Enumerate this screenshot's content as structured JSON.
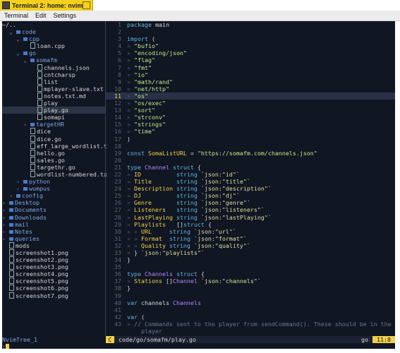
{
  "window": {
    "title": "Terminal 2: home: nvim"
  },
  "menu": [
    "Terminal",
    "Edit",
    "Settings"
  ],
  "tree": {
    "root": "~/..",
    "items": [
      {
        "indent": 1,
        "kind": "dir",
        "open": true,
        "name": "code"
      },
      {
        "indent": 2,
        "kind": "dir",
        "open": true,
        "name": "cpp"
      },
      {
        "indent": 3,
        "kind": "file",
        "name": "loan.cpp"
      },
      {
        "indent": 2,
        "kind": "dir",
        "open": true,
        "name": "go"
      },
      {
        "indent": 3,
        "kind": "dir",
        "open": true,
        "name": "somafm"
      },
      {
        "indent": 4,
        "kind": "file",
        "name": "channels.json"
      },
      {
        "indent": 4,
        "kind": "file",
        "name": "cntcharsp"
      },
      {
        "indent": 4,
        "kind": "file",
        "name": "list"
      },
      {
        "indent": 4,
        "kind": "file",
        "name": "mplayer-slave.txt"
      },
      {
        "indent": 4,
        "kind": "file",
        "name": "notes.txt.md"
      },
      {
        "indent": 4,
        "kind": "file",
        "name": "play"
      },
      {
        "indent": 4,
        "kind": "file",
        "name": "play.go",
        "selected": true
      },
      {
        "indent": 4,
        "kind": "file",
        "name": "somapi"
      },
      {
        "indent": 3,
        "kind": "dir",
        "open": false,
        "name": "targetHR"
      },
      {
        "indent": 3,
        "kind": "file",
        "name": "dice"
      },
      {
        "indent": 3,
        "kind": "file",
        "name": "dice.go"
      },
      {
        "indent": 3,
        "kind": "file",
        "name": "eff_large_wordlist.t"
      },
      {
        "indent": 3,
        "kind": "file",
        "name": "hello.go"
      },
      {
        "indent": 3,
        "kind": "file",
        "name": "sales.go"
      },
      {
        "indent": 3,
        "kind": "file",
        "name": "targethr.go"
      },
      {
        "indent": 3,
        "kind": "file",
        "name": "wordlist-numbered.tx"
      },
      {
        "indent": 2,
        "kind": "dir",
        "open": false,
        "name": "python"
      },
      {
        "indent": 2,
        "kind": "dir",
        "open": false,
        "name": "wumpus"
      },
      {
        "indent": 1,
        "kind": "dir",
        "open": false,
        "name": "config"
      },
      {
        "indent": 0,
        "kind": "dir",
        "open": false,
        "name": "Desktop"
      },
      {
        "indent": 0,
        "kind": "dir",
        "open": false,
        "name": "Documents"
      },
      {
        "indent": 0,
        "kind": "dir",
        "open": false,
        "name": "Downloads"
      },
      {
        "indent": 0,
        "kind": "dir",
        "open": false,
        "name": "mail"
      },
      {
        "indent": 0,
        "kind": "dir",
        "open": false,
        "name": "Notes"
      },
      {
        "indent": 0,
        "kind": "dir",
        "open": false,
        "name": "queries"
      },
      {
        "indent": 0,
        "kind": "file",
        "name": "mods"
      },
      {
        "indent": 0,
        "kind": "file",
        "name": "screenshot1.png"
      },
      {
        "indent": 0,
        "kind": "file",
        "name": "screenshot2.png"
      },
      {
        "indent": 0,
        "kind": "file",
        "name": "screenshot3.png"
      },
      {
        "indent": 0,
        "kind": "file",
        "name": "screenshot4.png"
      },
      {
        "indent": 0,
        "kind": "file",
        "name": "screenshot5.png"
      },
      {
        "indent": 0,
        "kind": "file",
        "name": "screenshot6.png"
      },
      {
        "indent": 0,
        "kind": "file",
        "name": "screenshot7.png"
      }
    ]
  },
  "editor": {
    "current_line": 11,
    "lines": [
      [
        [
          "kw",
          "package"
        ],
        [
          "pl",
          " main"
        ]
      ],
      [],
      [
        [
          "kw",
          "import"
        ],
        [
          "pl",
          " ("
        ]
      ],
      [
        [
          "dim",
          "» "
        ],
        [
          "str",
          "\"bufio\""
        ]
      ],
      [
        [
          "dim",
          "» "
        ],
        [
          "str",
          "\"encoding/json\""
        ]
      ],
      [
        [
          "dim",
          "» "
        ],
        [
          "str",
          "\"flag\""
        ]
      ],
      [
        [
          "dim",
          "» "
        ],
        [
          "str",
          "\"fmt\""
        ]
      ],
      [
        [
          "dim",
          "» "
        ],
        [
          "str",
          "\"io\""
        ]
      ],
      [
        [
          "dim",
          "» "
        ],
        [
          "str",
          "\"math/rand\""
        ]
      ],
      [
        [
          "dim",
          "» "
        ],
        [
          "str",
          "\"net/http\""
        ]
      ],
      [
        [
          "dim",
          "» "
        ],
        [
          "str",
          "\"os\""
        ]
      ],
      [
        [
          "dim",
          "» "
        ],
        [
          "str",
          "\"os/exec\""
        ]
      ],
      [
        [
          "dim",
          "» "
        ],
        [
          "str",
          "\"sort\""
        ]
      ],
      [
        [
          "dim",
          "» "
        ],
        [
          "str",
          "\"strconv\""
        ]
      ],
      [
        [
          "dim",
          "» "
        ],
        [
          "str",
          "\"strings\""
        ]
      ],
      [
        [
          "dim",
          "» "
        ],
        [
          "str",
          "\"time\""
        ]
      ],
      [
        [
          "pl",
          ")"
        ]
      ],
      [],
      [
        [
          "kw",
          "const"
        ],
        [
          "pl",
          " "
        ],
        [
          "id",
          "SomaListURL"
        ],
        [
          "pl",
          " = "
        ],
        [
          "str",
          "\"https://somafm.com/channels.json\""
        ]
      ],
      [],
      [
        [
          "kw",
          "type"
        ],
        [
          "pl",
          " "
        ],
        [
          "ty",
          "Channel"
        ],
        [
          "pl",
          " "
        ],
        [
          "kw",
          "struct"
        ],
        [
          "pl",
          " {"
        ]
      ],
      [
        [
          "dim",
          "» "
        ],
        [
          "id",
          "ID"
        ],
        [
          "pl",
          "          "
        ],
        [
          "kw",
          "string"
        ],
        [
          "pl",
          " "
        ],
        [
          "tag",
          "`json:\"id\"`"
        ]
      ],
      [
        [
          "dim",
          "» "
        ],
        [
          "id",
          "Title"
        ],
        [
          "pl",
          "       "
        ],
        [
          "kw",
          "string"
        ],
        [
          "pl",
          " "
        ],
        [
          "tag",
          "`json:\"title\"`"
        ]
      ],
      [
        [
          "dim",
          "» "
        ],
        [
          "id",
          "Description"
        ],
        [
          "pl",
          " "
        ],
        [
          "kw",
          "string"
        ],
        [
          "pl",
          " "
        ],
        [
          "tag",
          "`json:\"description\"`"
        ]
      ],
      [
        [
          "dim",
          "» "
        ],
        [
          "id",
          "DJ"
        ],
        [
          "pl",
          "          "
        ],
        [
          "kw",
          "string"
        ],
        [
          "pl",
          " "
        ],
        [
          "tag",
          "`json:\"dj\"`"
        ]
      ],
      [
        [
          "dim",
          "» "
        ],
        [
          "id",
          "Genre"
        ],
        [
          "pl",
          "       "
        ],
        [
          "kw",
          "string"
        ],
        [
          "pl",
          " "
        ],
        [
          "tag",
          "`json:\"genre\"`"
        ]
      ],
      [
        [
          "dim",
          "» "
        ],
        [
          "id",
          "Listeners"
        ],
        [
          "pl",
          "   "
        ],
        [
          "kw",
          "string"
        ],
        [
          "pl",
          " "
        ],
        [
          "tag",
          "`json:\"listeners\"`"
        ]
      ],
      [
        [
          "dim",
          "» "
        ],
        [
          "id",
          "LastPlaying"
        ],
        [
          "pl",
          " "
        ],
        [
          "kw",
          "string"
        ],
        [
          "pl",
          " "
        ],
        [
          "tag",
          "`json:\"lastPlaying\"`"
        ]
      ],
      [
        [
          "dim",
          "» "
        ],
        [
          "id",
          "Playlists"
        ],
        [
          "pl",
          "   []"
        ],
        [
          "kw",
          "struct"
        ],
        [
          "pl",
          " {"
        ]
      ],
      [
        [
          "dim",
          "» » "
        ],
        [
          "id",
          "URL"
        ],
        [
          "pl",
          "     "
        ],
        [
          "kw",
          "string"
        ],
        [
          "pl",
          " "
        ],
        [
          "tag",
          "`json:\"url\"`"
        ]
      ],
      [
        [
          "dim",
          "» » "
        ],
        [
          "id",
          "Format"
        ],
        [
          "pl",
          "  "
        ],
        [
          "kw",
          "string"
        ],
        [
          "pl",
          " "
        ],
        [
          "tag",
          "`json:\"format\"`"
        ]
      ],
      [
        [
          "dim",
          "» » "
        ],
        [
          "id",
          "Quality"
        ],
        [
          "pl",
          " "
        ],
        [
          "kw",
          "string"
        ],
        [
          "pl",
          " "
        ],
        [
          "tag",
          "`json:\"quality\"`"
        ]
      ],
      [
        [
          "dim",
          "» "
        ],
        [
          "pl",
          "} "
        ],
        [
          "tag",
          "`json:\"playlists\"`"
        ]
      ],
      [
        [
          "pl",
          "}"
        ]
      ],
      [],
      [
        [
          "kw",
          "type"
        ],
        [
          "pl",
          " "
        ],
        [
          "ty",
          "Channels"
        ],
        [
          "pl",
          " "
        ],
        [
          "kw",
          "struct"
        ],
        [
          "pl",
          " {"
        ]
      ],
      [
        [
          "dim",
          "» "
        ],
        [
          "id",
          "Stations"
        ],
        [
          "pl",
          " []"
        ],
        [
          "ty",
          "Channel"
        ],
        [
          "pl",
          " "
        ],
        [
          "tag",
          "`json:\"channels\"`"
        ]
      ],
      [
        [
          "pl",
          "}"
        ]
      ],
      [],
      [
        [
          "kw",
          "var"
        ],
        [
          "pl",
          " channels "
        ],
        [
          "ty",
          "Channels"
        ]
      ],
      [],
      [
        [
          "kw",
          "var"
        ],
        [
          "pl",
          " ("
        ]
      ],
      [
        [
          "dim",
          "» "
        ],
        [
          "cm",
          "// Commands sent to the player from sendCommand(). These should be in the M"
        ]
      ],
      [
        [
          "cm",
          "    player"
        ]
      ]
    ],
    "line_numbers": [
      "1",
      "2",
      "3",
      "4",
      "5",
      "6",
      "7",
      "8",
      "9",
      "10",
      "11",
      "12",
      "13",
      "14",
      "15",
      "16",
      "17",
      "18",
      "19",
      "20",
      "21",
      "22",
      "23",
      "24",
      "25",
      "26",
      "27",
      "28",
      "29",
      "30",
      "31",
      "32",
      "33",
      "34",
      "35",
      "36",
      "37",
      "38",
      "39",
      "40",
      "41",
      "42",
      "43",
      ""
    ]
  },
  "status": {
    "left": "NvimTree_1",
    "mode": "C",
    "file": "code/go/somafm/play.go",
    "filetype": "go",
    "position": "11:8"
  },
  "cmdline": ":",
  "colors": {
    "accent": "#f2cf4a",
    "background": "#101622",
    "titlebar": "#f5d020"
  }
}
